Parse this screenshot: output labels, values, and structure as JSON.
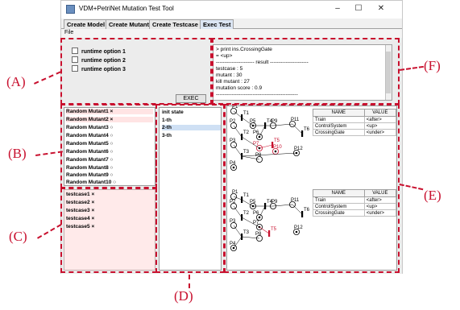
{
  "window": {
    "title": "VDM+PetriNet Mutation Test Tool",
    "controls": [
      "–",
      "☐",
      "✕"
    ]
  },
  "tabs": [
    {
      "label": "Create Model",
      "active": false
    },
    {
      "label": "Create Mutant",
      "active": false
    },
    {
      "label": "Create Testcase",
      "active": false
    },
    {
      "label": "Exec Test",
      "active": true
    }
  ],
  "menu": {
    "file": "File"
  },
  "runtime_options": [
    "runtime option 1",
    "runtime option 2",
    "runtime option 3"
  ],
  "exec_label": "EXEC",
  "console_lines": [
    "> print ins.CrossingGate",
    "= <up>",
    "---------------------- result ----------------------",
    "testcase : 5",
    "mutant : 30",
    "kill mutant : 27",
    "mutation score : 0.9",
    "-----------------------------------------------"
  ],
  "mutants": [
    {
      "label": "Random Mutant1 ×",
      "killed": true
    },
    {
      "label": "Random Mutant2 ×",
      "killed": true
    },
    {
      "label": "Random Mutant3 ○",
      "killed": false
    },
    {
      "label": "Random Mutant4 ○",
      "killed": false
    },
    {
      "label": "Random Mutant5 ○",
      "killed": false
    },
    {
      "label": "Random Mutant6 ○",
      "killed": false
    },
    {
      "label": "Random Mutant7 ○",
      "killed": false
    },
    {
      "label": "Random Mutant8 ○",
      "killed": false
    },
    {
      "label": "Random Mutant9 ○",
      "killed": false
    },
    {
      "label": "Random Mutant10 ○",
      "killed": false
    }
  ],
  "testcases": [
    "testcase1 ×",
    "testcase2 ×",
    "testcase3 ×",
    "testcase4 ×",
    "testcase5 ×"
  ],
  "states": {
    "items": [
      "init state",
      "1-th",
      "2-th",
      "3-th"
    ],
    "selected": 2
  },
  "value_table": {
    "headers": [
      "NAME",
      "VALUE"
    ],
    "rows_top": [
      [
        "Train",
        "<after>"
      ],
      [
        "ControlSystem",
        "<up>"
      ],
      [
        "CrossingGate",
        "<under>"
      ]
    ],
    "rows_bottom": [
      [
        "Train",
        "<after>"
      ],
      [
        "ControlSystem",
        "<up>"
      ],
      [
        "CrossingGate",
        "<under>"
      ]
    ]
  },
  "petri_top": {
    "places": [
      "P1",
      "P5",
      "P9",
      "P11",
      "P6",
      "P2",
      "P7",
      "P10",
      "P12",
      "P3",
      "P8",
      "P4"
    ],
    "transitions": [
      "T1",
      "T4",
      "T2",
      "T6",
      "T5",
      "T3"
    ]
  },
  "petri_bottom": {
    "places": [
      "P1",
      "P5",
      "P9",
      "P11",
      "P6",
      "P2",
      "P7",
      "P12",
      "P3",
      "P8",
      "P4"
    ],
    "transitions": [
      "T1",
      "T4",
      "T2",
      "T6",
      "T5",
      "T3"
    ]
  },
  "annotations": [
    "(A)",
    "(B)",
    "(C)",
    "(D)",
    "(E)",
    "(F)"
  ],
  "accent_color": "#c8102e"
}
